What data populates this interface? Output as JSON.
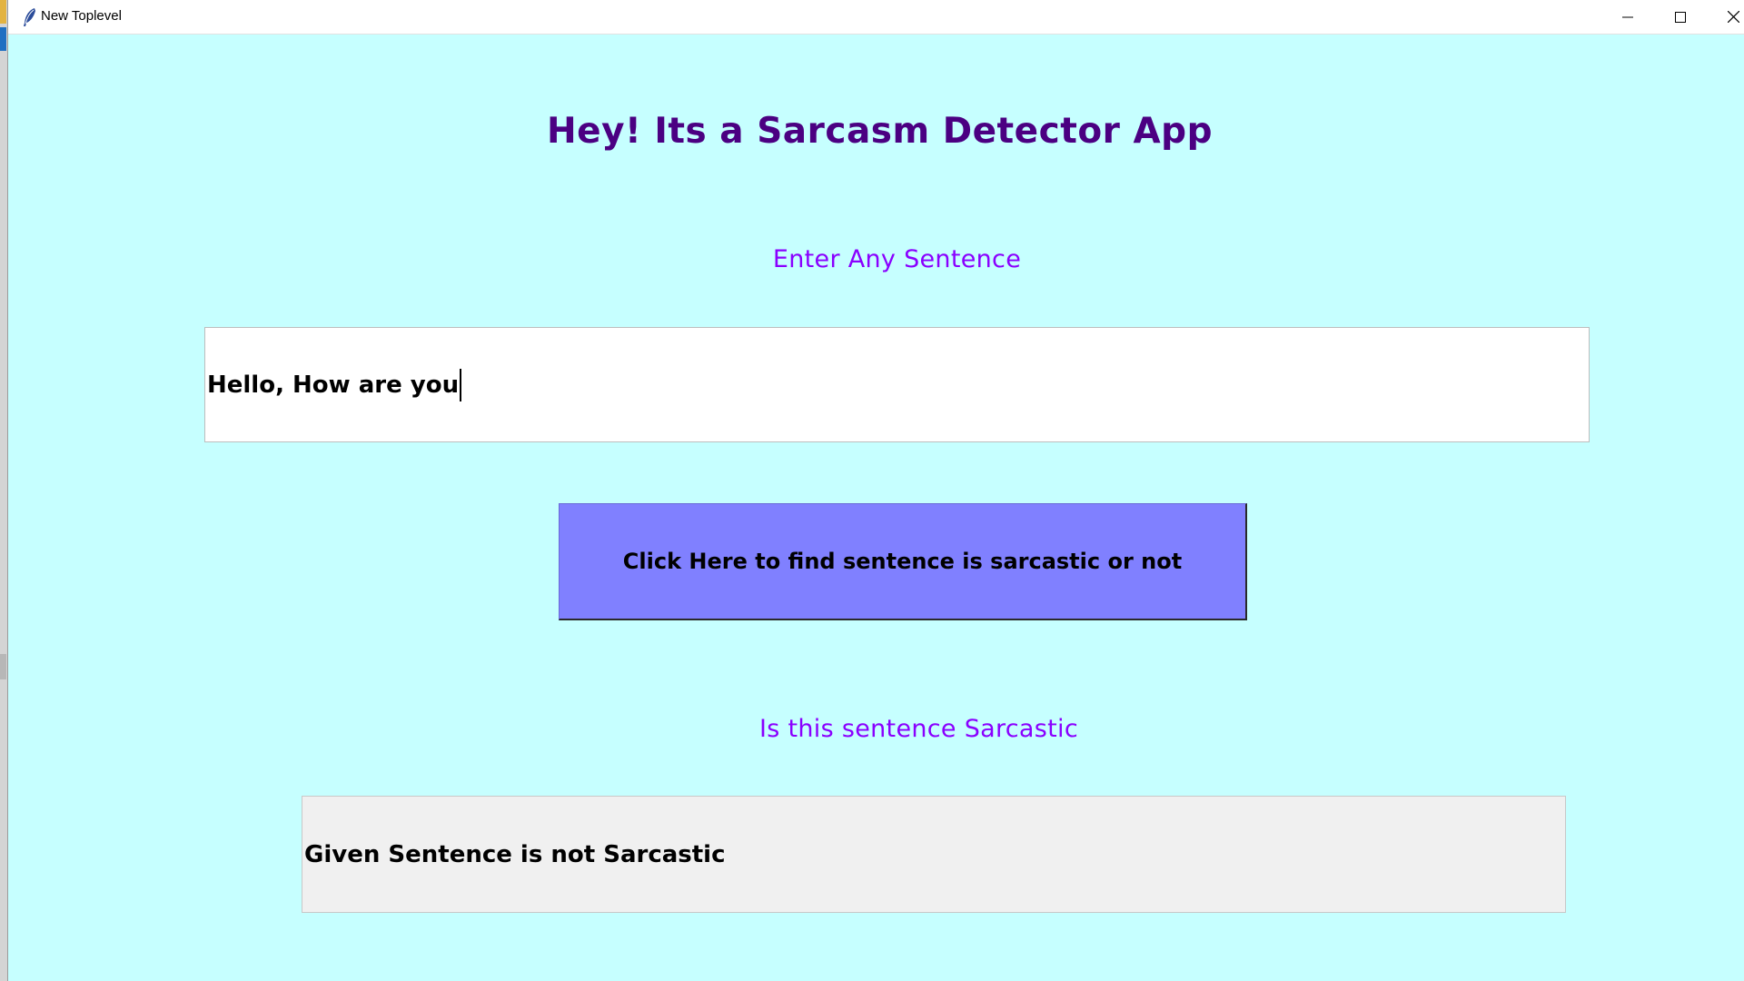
{
  "window": {
    "title": "New Toplevel",
    "controls": {
      "minimize": "minimize-icon",
      "maximize": "maximize-icon",
      "close": "close-icon"
    }
  },
  "app": {
    "title": "Hey! Its a Sarcasm Detector App",
    "input_label": "Enter Any Sentence",
    "input_value": "Hello, How are you",
    "button_label": "Click Here to find sentence is sarcastic or not",
    "result_label": "Is this sentence Sarcastic",
    "result_value": "Given Sentence is not Sarcastic"
  },
  "colors": {
    "background": "#c6ffff",
    "title": "#4b0082",
    "labels": "#8a00ff",
    "button": "#8080ff",
    "result_box": "#f0f0f0"
  }
}
